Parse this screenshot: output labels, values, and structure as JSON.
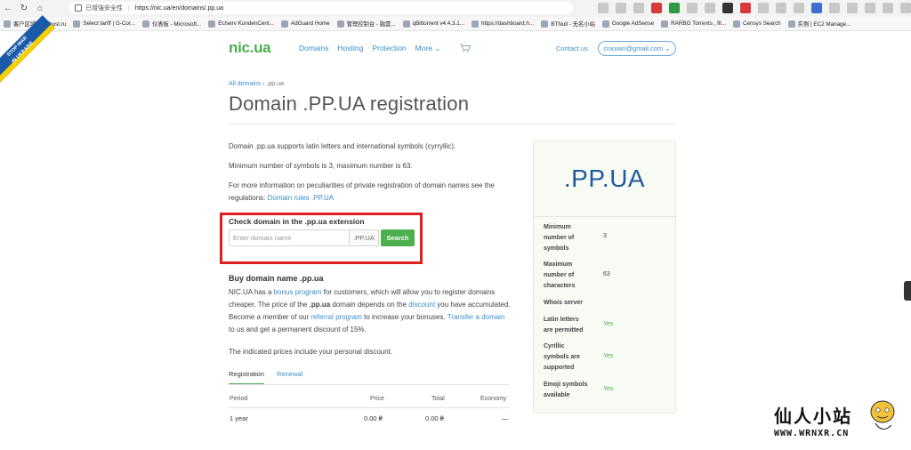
{
  "browser": {
    "security_label": "已增強安全性",
    "url": "https://nic.ua/en/domains/.pp.ua",
    "bookmarks": [
      "客户区域 | justhost.ru",
      "Select tariff | G-Cor...",
      "仪表板 - Microsoft...",
      "EUserv KundenCent...",
      "AdGuard Home",
      "管理控制台 - 融雲...",
      "qBittorrent v4.4.3.1...",
      "https://dashboard.h...",
      "BTNull - 无名小站",
      "Google AdSense",
      "RARBG Torrents , fil...",
      "Censys Search",
      "实例 | EC2 Manage..."
    ]
  },
  "banner": {
    "line1": "STOP WAR",
    "line2": "IN UKRAINE"
  },
  "header": {
    "logo": "nic.ua",
    "nav": [
      "Domains",
      "Hosting",
      "Protection",
      "More ⌄"
    ],
    "contact": "Contact us",
    "account": "cnxxwn@gmail.com ⌄"
  },
  "breadcrumb": {
    "link": "All domains",
    "separator": "›",
    "current": ".pp.ua"
  },
  "title": "Domain .PP.UA registration",
  "intro": {
    "p1": "Domain .pp.ua supports latin letters and international symbols (cyrryllic).",
    "p2": "Minimum number of symbols is 3, maximum number is 63.",
    "p3": "For more information on peculiarities of private registration of domain names see the regulations:",
    "p3_link": "Domain rules .PP.UA"
  },
  "check": {
    "title": "Check domain in the .pp.ua extension",
    "placeholder": "Enter domain name",
    "extension": ".PP.UA",
    "button": "Search"
  },
  "buy": {
    "title": "Buy domain name .pp.ua",
    "t1": "NIC.UA has a",
    "l1": "bonus program",
    "t2": "for customers, which will allow you to register domains cheaper. The price of the",
    "b1": ".pp.ua",
    "t3": "domain depends on the",
    "l2": "discount",
    "t4": "you have accumulated. Become a member of our",
    "l3": "referral program",
    "t5": "to increase your bonuses.",
    "l4": "Transfer a domain",
    "t6": "to us and get a permanent discount of 15%.",
    "note": "The indicated prices include your personal discount."
  },
  "tabs": [
    "Registration",
    "Renewal"
  ],
  "table": {
    "headers": [
      "Period",
      "Price",
      "Total",
      "Economy"
    ],
    "rows": [
      [
        "1 year",
        "0.00 ₴",
        "0.00 ₴",
        "—"
      ]
    ]
  },
  "sidebar": {
    "title": ".PP.UA",
    "props": [
      {
        "label": "Minimum number of symbols",
        "value": "3"
      },
      {
        "label": "Maximum number of characters",
        "value": "63"
      },
      {
        "label": "Whois server",
        "value": ""
      },
      {
        "label": "Latin letters are permitted",
        "value": "Yes"
      },
      {
        "label": "Cyrillic symbols are supported",
        "value": "Yes"
      },
      {
        "label": "Emoji symbols available",
        "value": "Yes"
      }
    ]
  },
  "watermark": {
    "text": "仙人小站",
    "url": "WWW.WRNXR.CN"
  },
  "colors": {
    "brand_green": "#4caf50",
    "link_blue": "#3a8fc8",
    "title_blue": "#1f5a9a",
    "highlight_red": "#e02020"
  }
}
